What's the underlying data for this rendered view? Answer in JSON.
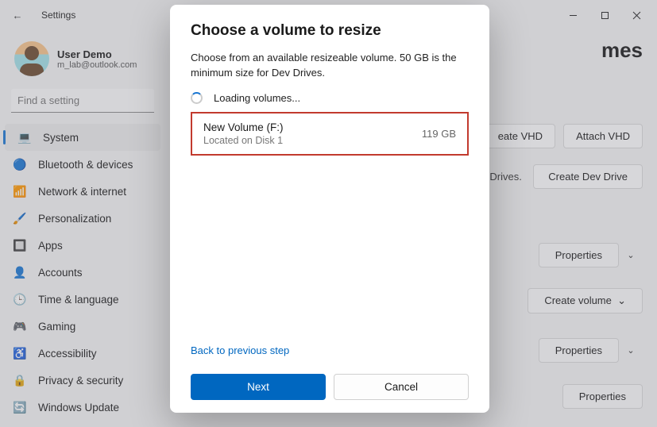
{
  "titlebar": {
    "title": "Settings"
  },
  "user": {
    "name": "User Demo",
    "email": "m_lab@outlook.com"
  },
  "search": {
    "placeholder": "Find a setting"
  },
  "nav": [
    {
      "label": "System",
      "icon": "💻",
      "selected": true
    },
    {
      "label": "Bluetooth & devices",
      "icon": "🔵"
    },
    {
      "label": "Network & internet",
      "icon": "📶"
    },
    {
      "label": "Personalization",
      "icon": "🖌️"
    },
    {
      "label": "Apps",
      "icon": "🔲"
    },
    {
      "label": "Accounts",
      "icon": "👤"
    },
    {
      "label": "Time & language",
      "icon": "🕒"
    },
    {
      "label": "Gaming",
      "icon": "🎮"
    },
    {
      "label": "Accessibility",
      "icon": "♿"
    },
    {
      "label": "Privacy & security",
      "icon": "🔒"
    },
    {
      "label": "Windows Update",
      "icon": "🔄"
    }
  ],
  "right": {
    "title_suffix": "mes",
    "btn_create_vhd": "eate VHD",
    "btn_attach_vhd": "Attach VHD",
    "dev_drives_text": "Dev Drives.",
    "btn_create_dev": "Create Dev Drive",
    "btn_properties": "Properties",
    "btn_create_volume": "Create volume"
  },
  "modal": {
    "title": "Choose a volume to resize",
    "desc": "Choose from an available resizeable volume. 50 GB is the minimum size for Dev Drives.",
    "loading_text": "Loading volumes...",
    "volume": {
      "name": "New Volume (F:)",
      "location": "Located on Disk 1",
      "size": "119 GB"
    },
    "back_link": "Back to previous step",
    "btn_next": "Next",
    "btn_cancel": "Cancel"
  }
}
